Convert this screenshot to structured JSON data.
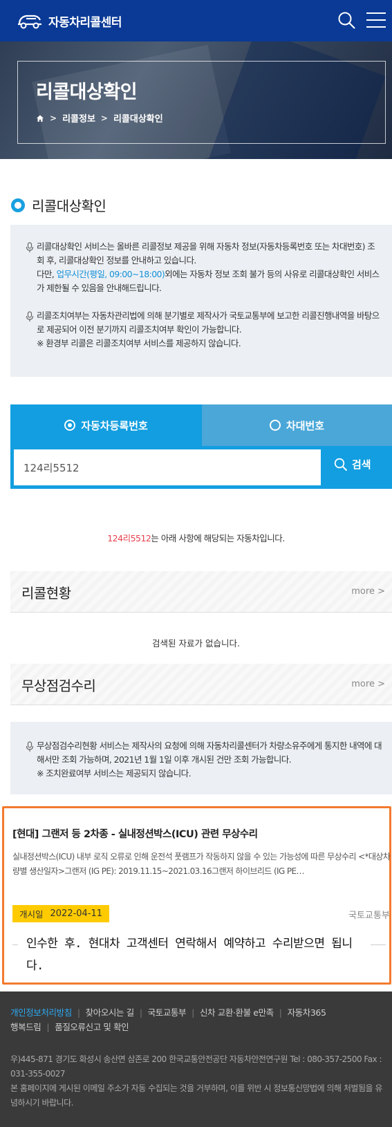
{
  "header": {
    "logo_text": "자동차리콜센터",
    "search_icon": "search-icon",
    "menu_icon": "hamburger-menu-icon"
  },
  "hero": {
    "title": "리콜대상확인",
    "breadcrumb": [
      "리콜정보",
      "리콜대상확인"
    ]
  },
  "section": {
    "title": "리콜대상확인"
  },
  "notice": {
    "p1_line": "리콜대상확인 서비스는 올바른 리콜정보 제공을 위해 자동차 정보(자동차등록번호 또는 차대번호) 조회 후, 리콜대상확인 정보를 안내하고 있습니다.",
    "p1_pre": "다만, ",
    "p1_hours": "업무시간(평일, 09:00~18:00)",
    "p1_post": "외에는 자동차 정보 조회 불가 등의 사유로 리콜대상확인 서비스가 제한될 수 있음을 안내해드립니다.",
    "p2_line": "리콜조치여부는 자동차관리법에 의해 분기별로 제작사가 국토교통부에 보고한 리콜진행내역을 바탕으로 제공되어 이전 분기까지 리콜조치여부 확인이 가능합니다.",
    "p2_warn": "※ 환경부 리콜은 리콜조치여부 서비스를 제공하지 않습니다."
  },
  "search": {
    "tab_reg": "자동차등록번호",
    "tab_vin": "차대번호",
    "value": "124리5512",
    "button": "검색"
  },
  "result": {
    "plate": "124리5512",
    "message": "는 아래 사항에 해당되는 자동차입니다."
  },
  "recall_panel": {
    "title": "리콜현황",
    "more": "more",
    "empty": "검색된 자료가 없습니다."
  },
  "free_panel": {
    "title": "무상점검수리",
    "more": "more",
    "notice": "무상점검수리현황 서비스는 제작사의 요청에 의해 자동차리콜센터가 차량소유주에게 통지한 내역에 대해서만 조회 가능하며, 2021년 1월 1일 이후 개시된 건만 조회 가능합니다.",
    "warn": "※ 조치완료여부 서비스는 제공되지 않습니다."
  },
  "item": {
    "title": "[현대] 그랜저 등 2차종 - 실내정션박스(ICU) 관련 무상수리",
    "desc": "실내정션박스(ICU) 내부 로직 오류로 인해 운전석 풋램프가 작동하지 않을 수 있는 가능성에 따른 무상수리 <*대상차량별 생산일자>그랜저 (IG PE): 2019.11.15~2021.03.16그랜저 하이브리드 (IG PE…",
    "date_label": "개시일",
    "date": "2022-04-11",
    "org": "국토교통부",
    "memo": "인수한 후. 현대차 고객센터 연락해서  예약하고  수리받으면 됩니다."
  },
  "footer": {
    "links": [
      "개인정보처리방침",
      "찾아오시는 길",
      "국토교통부",
      "신차 교환·환불 e만족",
      "자동차365",
      "행복드림",
      "품질오류신고 및 확인"
    ],
    "address": "우)445-871 경기도 화성시 송산면 삼존로 200 한국교통안전공단 자동차안전연구원 Tel : 080-357-2500 Fax : 031-355-0027",
    "disclaimer": "본 홈페이지에 게시된 이메일 주소가 자동 수집되는 것을 거부하며, 이를 위반 시 정보통신망법에 의해 처벌됨을 유념하시기 바랍니다."
  },
  "colors": {
    "header_bg": "#0a3a96",
    "accent_blue": "#129ee0",
    "warn_orange": "#f37b2f",
    "plate_red": "#e6404d",
    "badge_yellow": "#ffcb00",
    "footer_bg": "#3a3a3a"
  }
}
